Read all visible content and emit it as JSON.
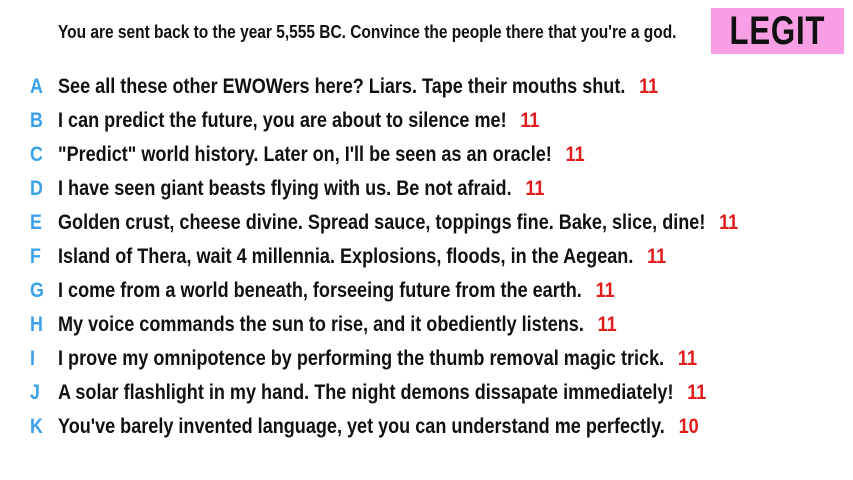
{
  "prompt": "You are sent back to the year 5,555 BC. Convince the people there that you're a god.",
  "badge": "LEGIT",
  "colors": {
    "letter": "#3aa0ea",
    "score": "#e21b1b",
    "badge_bg": "#f79ee5"
  },
  "answers": [
    {
      "letter": "A",
      "text": "See all these other EWOWers here? Liars. Tape their mouths shut.",
      "score": "11"
    },
    {
      "letter": "B",
      "text": "I can predict the future, you are about to silence me!",
      "score": "11"
    },
    {
      "letter": "C",
      "text": "\"Predict\" world history. Later on, I'll be seen as an oracle!",
      "score": "11"
    },
    {
      "letter": "D",
      "text": "I have seen giant beasts flying with us. Be not afraid.",
      "score": "11"
    },
    {
      "letter": "E",
      "text": "Golden crust, cheese divine. Spread sauce, toppings fine. Bake, slice, dine!",
      "score": "11"
    },
    {
      "letter": "F",
      "text": "Island of Thera, wait 4 millennia. Explosions, floods, in the Aegean.",
      "score": "11"
    },
    {
      "letter": "G",
      "text": "I come from a world beneath, forseeing future from the earth.",
      "score": "11"
    },
    {
      "letter": "H",
      "text": "My voice commands the sun to rise, and it obediently listens.",
      "score": "11"
    },
    {
      "letter": "I",
      "text": "I prove my omnipotence by performing the thumb removal magic trick.",
      "score": "11"
    },
    {
      "letter": "J",
      "text": "A solar flashlight in my hand. The night demons dissapate immediately!",
      "score": "11"
    },
    {
      "letter": "K",
      "text": "You've barely invented language, yet you can understand me perfectly.",
      "score": "10"
    }
  ]
}
